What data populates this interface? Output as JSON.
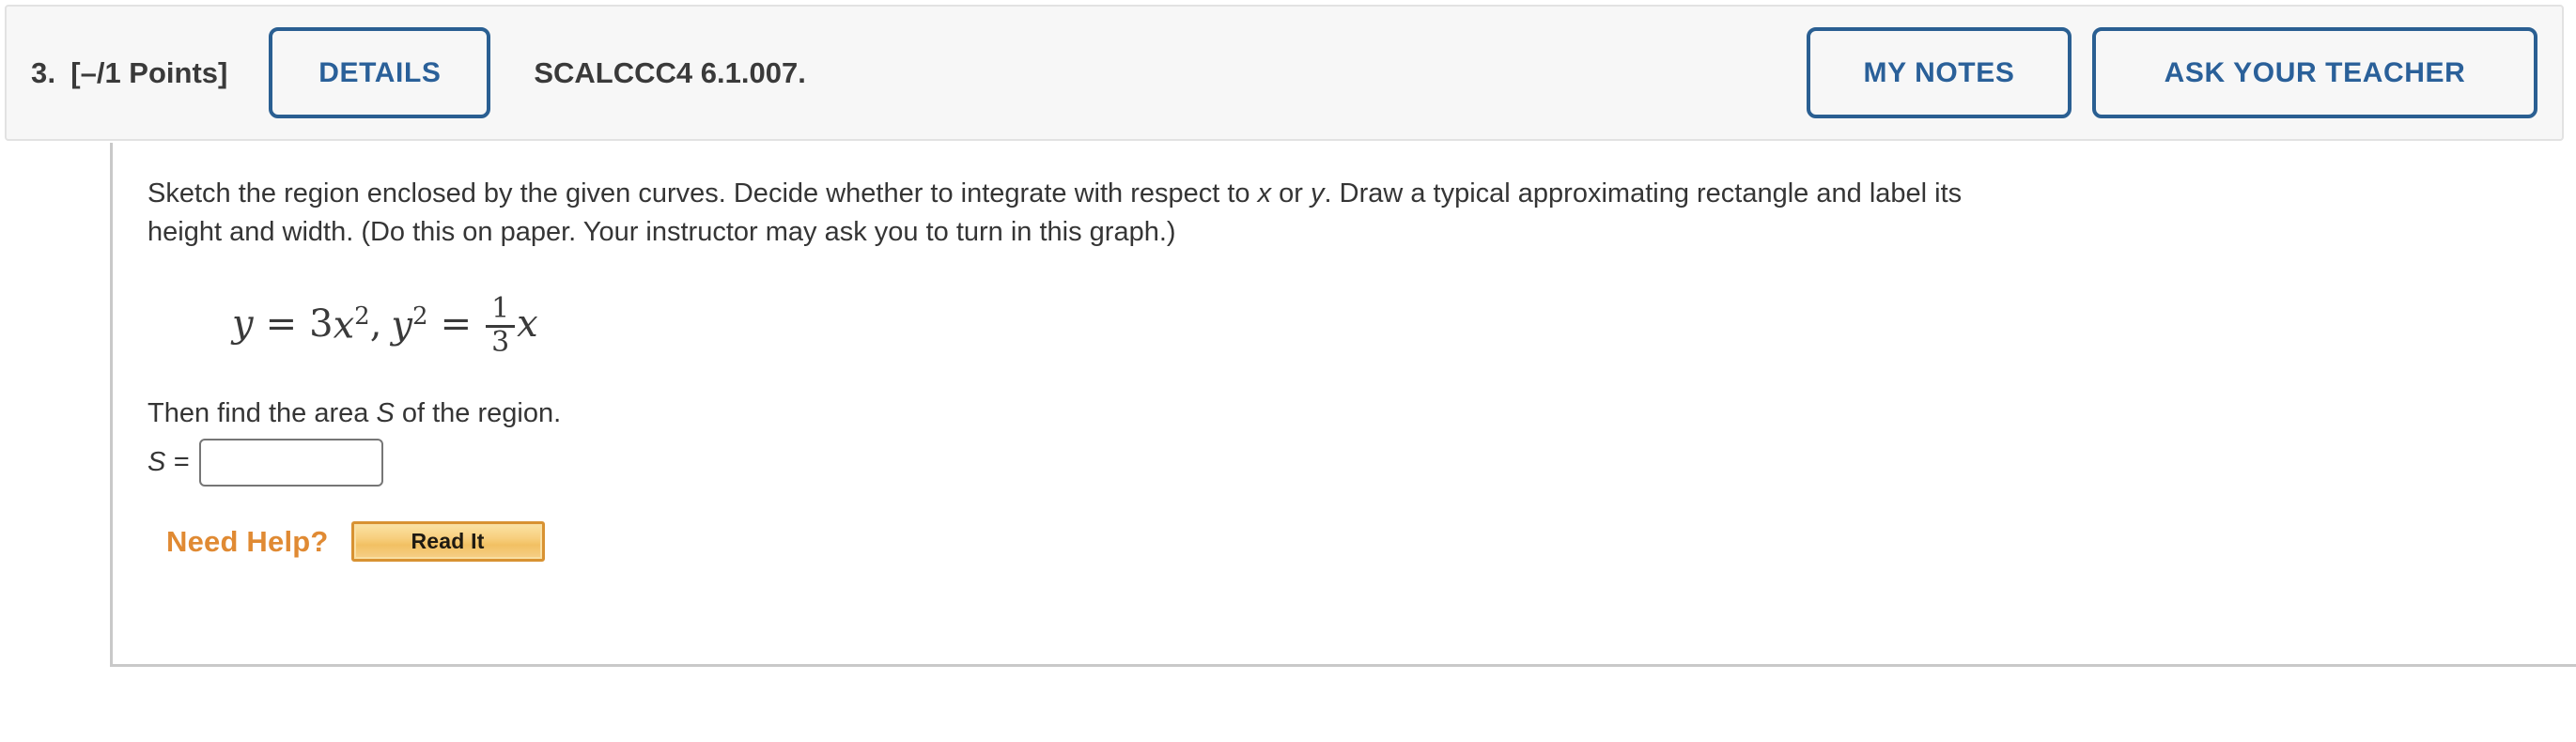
{
  "header": {
    "question_number": "3.",
    "points": "[–/1 Points]",
    "details_label": "DETAILS",
    "problem_code": "SCALCCC4 6.1.007.",
    "my_notes_label": "MY NOTES",
    "ask_teacher_label": "ASK YOUR TEACHER",
    "accent_color": "#2a5f92",
    "background_color": "#f7f7f7"
  },
  "question": {
    "prompt_line_1_a": "Sketch the region enclosed by the given curves. Decide whether to integrate with respect to ",
    "prompt_var_x": "x",
    "prompt_line_1_b": " or ",
    "prompt_var_y": "y",
    "prompt_line_1_c": ". Draw a typical approximating rectangle and label its",
    "prompt_line_2": "height and width. (Do this on paper. Your instructor may ask you to turn in this graph.)",
    "equation": {
      "text": "y = 3x², y² = (1/3)x",
      "lhs_var": "y",
      "equals": "=",
      "coef": "3",
      "x_var": "x",
      "exp_2": "2",
      "comma": ",",
      "y_var": "y",
      "y_exp": "2",
      "equals_2": "=",
      "frac_num": "1",
      "frac_den": "3",
      "frac_x": "x"
    },
    "then_find_a": "Then find the area ",
    "then_find_var": "S",
    "then_find_b": " of the region.",
    "answer_label": "S =",
    "answer_value": "",
    "answer_placeholder": ""
  },
  "help": {
    "need_help_label": "Need Help?",
    "read_it_label": "Read It",
    "need_help_color": "#e08a33",
    "read_it_border_color": "#d89232"
  }
}
